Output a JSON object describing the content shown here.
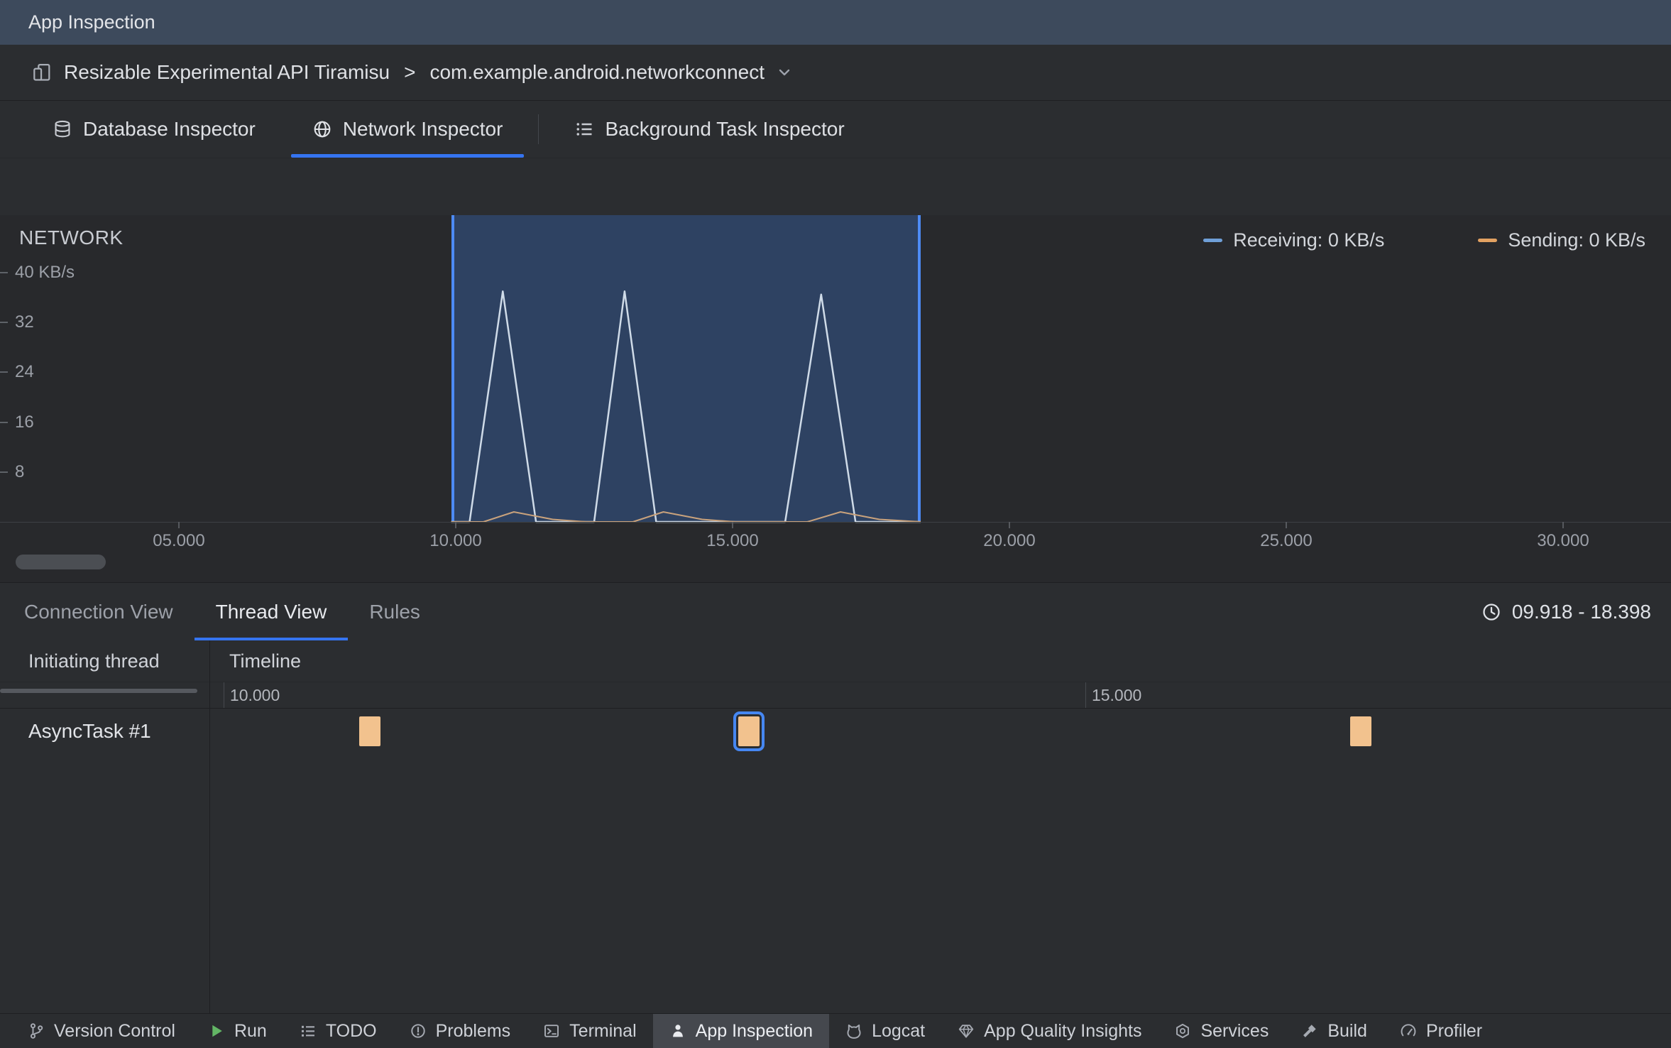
{
  "colors": {
    "accent_blue": "#3574f0",
    "selection_border": "#4d8bf5",
    "receiving_blue": "#6f9fd8",
    "sending_orange": "#e2a161",
    "event_fill": "#f2c28e",
    "title_bar_bg": "#3d4a5c"
  },
  "title_bar": {
    "title": "App Inspection"
  },
  "process_bar": {
    "device": "Resizable Experimental API Tiramisu",
    "separator": ">",
    "process": "com.example.android.networkconnect"
  },
  "inspector_tabs": [
    {
      "label": "Database Inspector",
      "icon": "database-icon",
      "selected": false
    },
    {
      "label": "Network Inspector",
      "icon": "globe-icon",
      "selected": true
    },
    {
      "label": "Background Task Inspector",
      "icon": "task-list-icon",
      "selected": false
    }
  ],
  "chart_data": {
    "type": "area",
    "title": "NETWORK",
    "ylabel": "KB/s",
    "ylim": [
      0,
      44
    ],
    "x_visible_range_s": [
      2,
      32
    ],
    "yticks": [
      {
        "value": 40,
        "label": "40 KB/s"
      },
      {
        "value": 32,
        "label": "32"
      },
      {
        "value": 24,
        "label": "24"
      },
      {
        "value": 16,
        "label": "16"
      },
      {
        "value": 8,
        "label": "8"
      }
    ],
    "xticks": [
      "05.000",
      "10.000",
      "15.000",
      "20.000",
      "25.000",
      "30.000"
    ],
    "legend": [
      {
        "name": "Receiving",
        "label": "Receiving: 0 KB/s",
        "color": "#6f9fd8"
      },
      {
        "name": "Sending",
        "label": "Sending: 0 KB/s",
        "color": "#e2a161"
      }
    ],
    "selection": {
      "start_s": 9.918,
      "end_s": 18.398
    },
    "series": [
      {
        "name": "Receiving KB/s",
        "color": "#cfdbe8",
        "width": 2.5,
        "points": [
          [
            9.918,
            0
          ],
          [
            10.25,
            0
          ],
          [
            10.85,
            37
          ],
          [
            11.45,
            0
          ],
          [
            12.5,
            0
          ],
          [
            13.05,
            37
          ],
          [
            13.62,
            0
          ],
          [
            14.6,
            0
          ],
          [
            15.95,
            0
          ],
          [
            16.6,
            36.5
          ],
          [
            17.22,
            0
          ],
          [
            18.398,
            0
          ]
        ]
      },
      {
        "name": "Sending KB/s",
        "color": "#c9a27c",
        "width": 2,
        "points": [
          [
            9.918,
            0
          ],
          [
            10.5,
            0
          ],
          [
            11.05,
            1.6
          ],
          [
            11.75,
            0.4
          ],
          [
            12.35,
            0
          ],
          [
            13.2,
            0
          ],
          [
            13.75,
            1.6
          ],
          [
            14.45,
            0.4
          ],
          [
            15.05,
            0
          ],
          [
            16.35,
            0
          ],
          [
            16.95,
            1.6
          ],
          [
            17.65,
            0.4
          ],
          [
            18.398,
            0
          ]
        ]
      }
    ]
  },
  "detail_tabs": {
    "items": [
      {
        "label": "Connection View",
        "selected": false
      },
      {
        "label": "Thread View",
        "selected": true
      },
      {
        "label": "Rules",
        "selected": false
      }
    ],
    "time_range": "09.918 - 18.398"
  },
  "thread_table": {
    "columns": [
      "Initiating thread",
      "Timeline"
    ],
    "range_start_s": 9.918,
    "range_end_s": 18.398,
    "ruler_ticks": [
      "10.000",
      "15.000"
    ],
    "rows": [
      {
        "thread": "AsyncTask #1",
        "events": [
          {
            "t": 10.85,
            "selected": false
          },
          {
            "t": 13.05,
            "selected": true
          },
          {
            "t": 16.6,
            "selected": false
          }
        ]
      }
    ]
  },
  "status_bar": {
    "items": [
      {
        "label": "Version Control",
        "icon": "branch-icon",
        "selected": false
      },
      {
        "label": "Run",
        "icon": "run-icon",
        "selected": false
      },
      {
        "label": "TODO",
        "icon": "todo-icon",
        "selected": false
      },
      {
        "label": "Problems",
        "icon": "problems-icon",
        "selected": false
      },
      {
        "label": "Terminal",
        "icon": "terminal-icon",
        "selected": false
      },
      {
        "label": "App Inspection",
        "icon": "app-inspection-icon",
        "selected": true
      },
      {
        "label": "Logcat",
        "icon": "logcat-icon",
        "selected": false
      },
      {
        "label": "App Quality Insights",
        "icon": "gem-icon",
        "selected": false
      },
      {
        "label": "Services",
        "icon": "services-icon",
        "selected": false
      },
      {
        "label": "Build",
        "icon": "build-icon",
        "selected": false
      },
      {
        "label": "Profiler",
        "icon": "profiler-icon",
        "selected": false
      }
    ]
  }
}
